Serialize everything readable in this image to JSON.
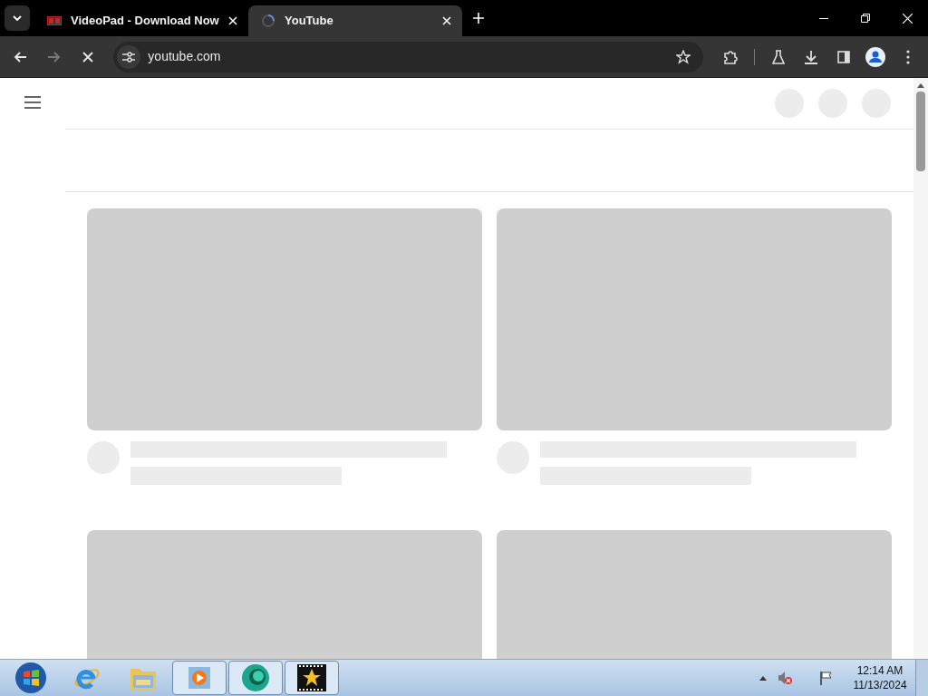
{
  "browser": {
    "tabs": [
      {
        "title": "VideoPad - Download Now",
        "kind": "videopad",
        "selected": false
      },
      {
        "title": "YouTube",
        "kind": "loading",
        "selected": true
      }
    ],
    "address": "youtube.com"
  },
  "taskbar": {
    "items": [
      {
        "kind": "start",
        "running": false
      },
      {
        "kind": "ie",
        "running": false
      },
      {
        "kind": "folder",
        "running": false
      },
      {
        "kind": "media",
        "running": true
      },
      {
        "kind": "green",
        "running": true
      },
      {
        "kind": "star",
        "running": true
      }
    ],
    "time": "12:14 AM",
    "date": "11/13/2024"
  }
}
